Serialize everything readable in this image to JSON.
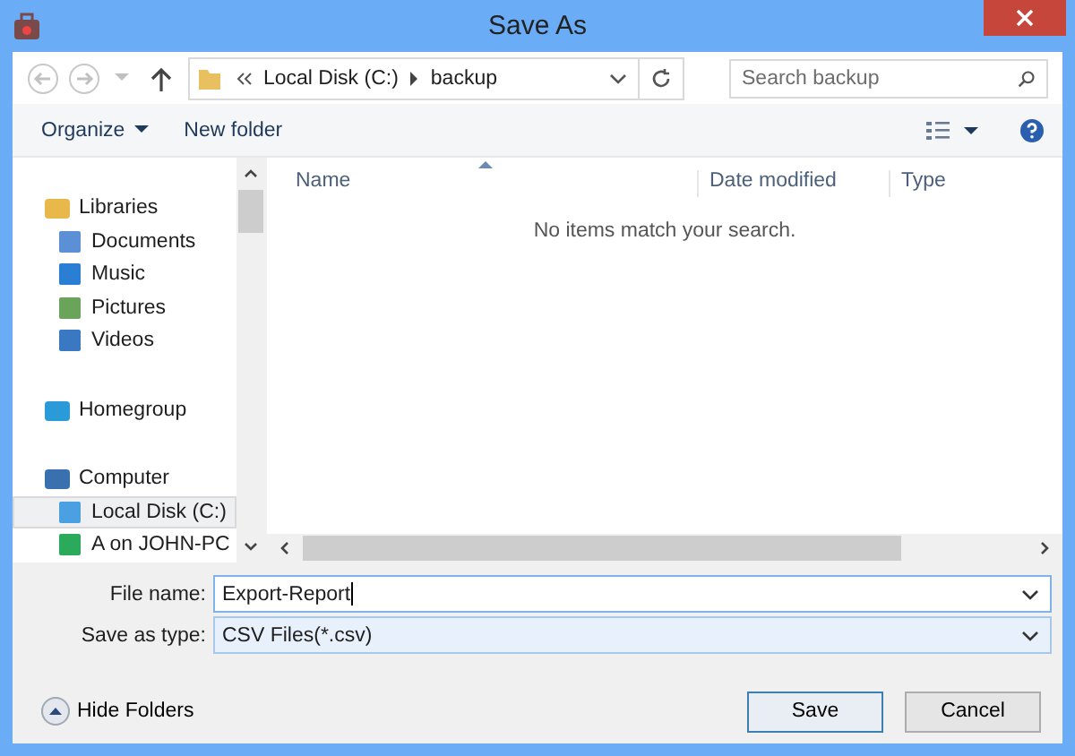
{
  "window": {
    "title": "Save As"
  },
  "address": {
    "crumbs": [
      "Local Disk (C:)",
      "backup"
    ]
  },
  "search": {
    "placeholder": "Search backup"
  },
  "toolbar": {
    "organize": "Organize",
    "new_folder": "New folder"
  },
  "sidebar": {
    "items": [
      {
        "label": "Libraries",
        "selected": false,
        "children": [
          {
            "label": "Documents",
            "selected": false
          },
          {
            "label": "Music",
            "selected": false
          },
          {
            "label": "Pictures",
            "selected": false
          },
          {
            "label": "Videos",
            "selected": false
          }
        ]
      },
      {
        "label": "Homegroup",
        "selected": false
      },
      {
        "label": "Computer",
        "selected": false,
        "children": [
          {
            "label": "Local Disk (C:)",
            "selected": true
          },
          {
            "label": "A on JOHN-PC",
            "selected": false
          }
        ]
      }
    ]
  },
  "table": {
    "columns": [
      "Name",
      "Date modified",
      "Type"
    ],
    "empty_message": "No items match your search."
  },
  "form": {
    "file_name_label": "File name:",
    "file_name": "Export-Report",
    "type_label": "Save as type:",
    "type": "CSV Files(*.csv)"
  },
  "footer": {
    "hide_folders": "Hide Folders",
    "buttons": [
      "Save",
      "Cancel"
    ]
  }
}
